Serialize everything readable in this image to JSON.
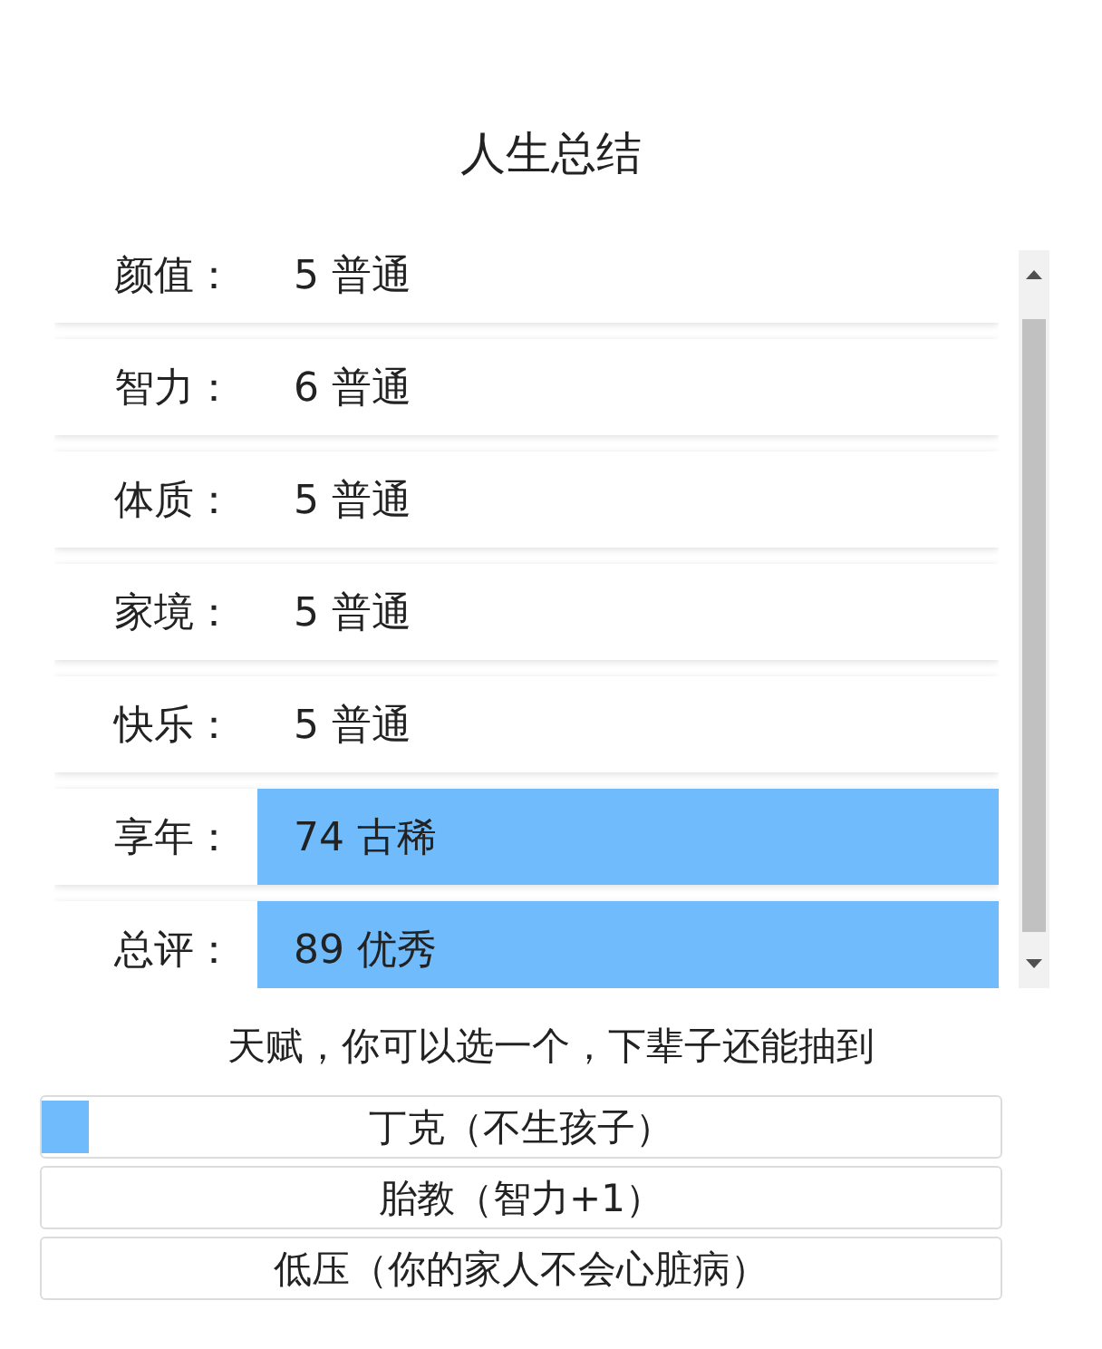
{
  "title": "人生总结",
  "summary": {
    "rows": [
      {
        "label": "颜值：",
        "value": "5 普通",
        "highlighted": false
      },
      {
        "label": "智力：",
        "value": "6 普通",
        "highlighted": false
      },
      {
        "label": "体质：",
        "value": "5 普通",
        "highlighted": false
      },
      {
        "label": "家境：",
        "value": "5 普通",
        "highlighted": false
      },
      {
        "label": "快乐：",
        "value": "5 普通",
        "highlighted": false
      },
      {
        "label": "享年：",
        "value": "74 古稀",
        "highlighted": true
      },
      {
        "label": "总评：",
        "value": "89 优秀",
        "highlighted": true
      }
    ]
  },
  "talents": {
    "prompt": "天赋，你可以选一个，下辈子还能抽到",
    "options": [
      {
        "label": "丁克（不生孩子）",
        "level": 0.05
      },
      {
        "label": "胎教（智力+1）"
      },
      {
        "label": "低压（你的家人不会心脏病）"
      }
    ]
  }
}
